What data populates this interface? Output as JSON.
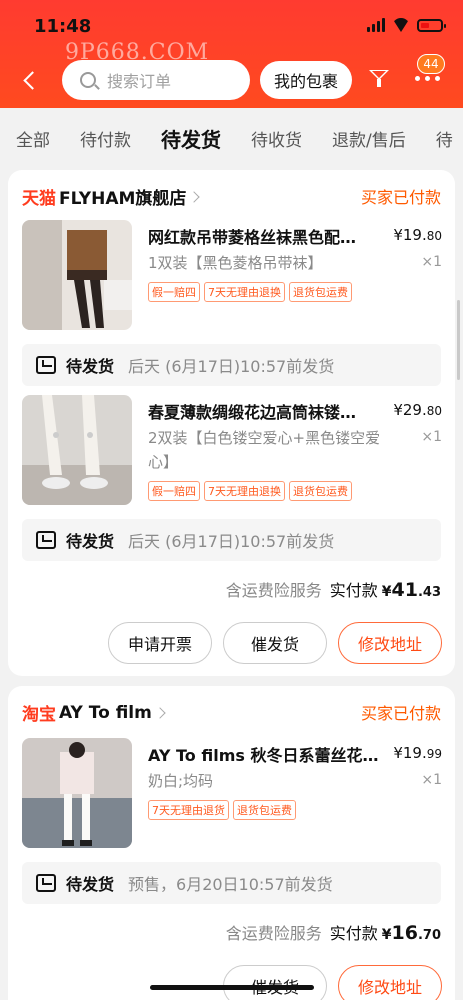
{
  "status_bar": {
    "time": "11:48"
  },
  "watermark": "9P668.COM",
  "header": {
    "search_placeholder": "搜索订单",
    "my_package_label": "我的包裹",
    "message_badge": "44"
  },
  "tabs": [
    {
      "label": "全部",
      "active": false
    },
    {
      "label": "待付款",
      "active": false
    },
    {
      "label": "待发货",
      "active": true
    },
    {
      "label": "待收货",
      "active": false
    },
    {
      "label": "退款/售后",
      "active": false
    },
    {
      "label": "待",
      "active": false
    }
  ],
  "orders": [
    {
      "platform": "天猫",
      "shop": "FLYHAM旗舰店",
      "status": "买家已付款",
      "items": [
        {
          "title": "网红款吊带菱格丝袜黑色配…",
          "price_int": "¥19.",
          "price_dec": "80",
          "sku": "1双装【黑色菱格吊带袜】",
          "qty": "×1",
          "tags": [
            "假一赔四",
            "7天无理由退换",
            "退货包运费"
          ],
          "ship_label": "待发货",
          "ship_time": "后天 (6月17日)10:57前发货"
        },
        {
          "title": "春夏薄款绸缎花边高筒袜镂…",
          "price_int": "¥29.",
          "price_dec": "80",
          "sku": "2双装【白色镂空爱心+黑色镂空爱心】",
          "qty": "×1",
          "tags": [
            "假一赔四",
            "7天无理由退换",
            "退货包运费"
          ],
          "ship_label": "待发货",
          "ship_time": "后天 (6月17日)10:57前发货"
        }
      ],
      "total": {
        "insurance": "含运费险服务",
        "label": "实付款",
        "currency": "¥",
        "amount": "41",
        "decimal": ".43"
      },
      "buttons": {
        "invoice": "申请开票",
        "urge": "催发货",
        "address": "修改地址"
      }
    },
    {
      "platform": "淘宝",
      "shop": "AY To film",
      "status": "买家已付款",
      "items": [
        {
          "title": "AY To films 秋冬日系蕾丝花…",
          "price_int": "¥19.",
          "price_dec": "99",
          "sku": "奶白;均码",
          "qty": "×1",
          "tags": [
            "7天无理由退货",
            "退货包运费"
          ],
          "ship_label": "待发货",
          "ship_time": "预售，6月20日10:57前发货"
        }
      ],
      "total": {
        "insurance": "含运费险服务",
        "label": "实付款",
        "currency": "¥",
        "amount": "16",
        "decimal": ".70"
      },
      "buttons": {
        "urge": "催发货",
        "address": "修改地址"
      }
    }
  ]
}
